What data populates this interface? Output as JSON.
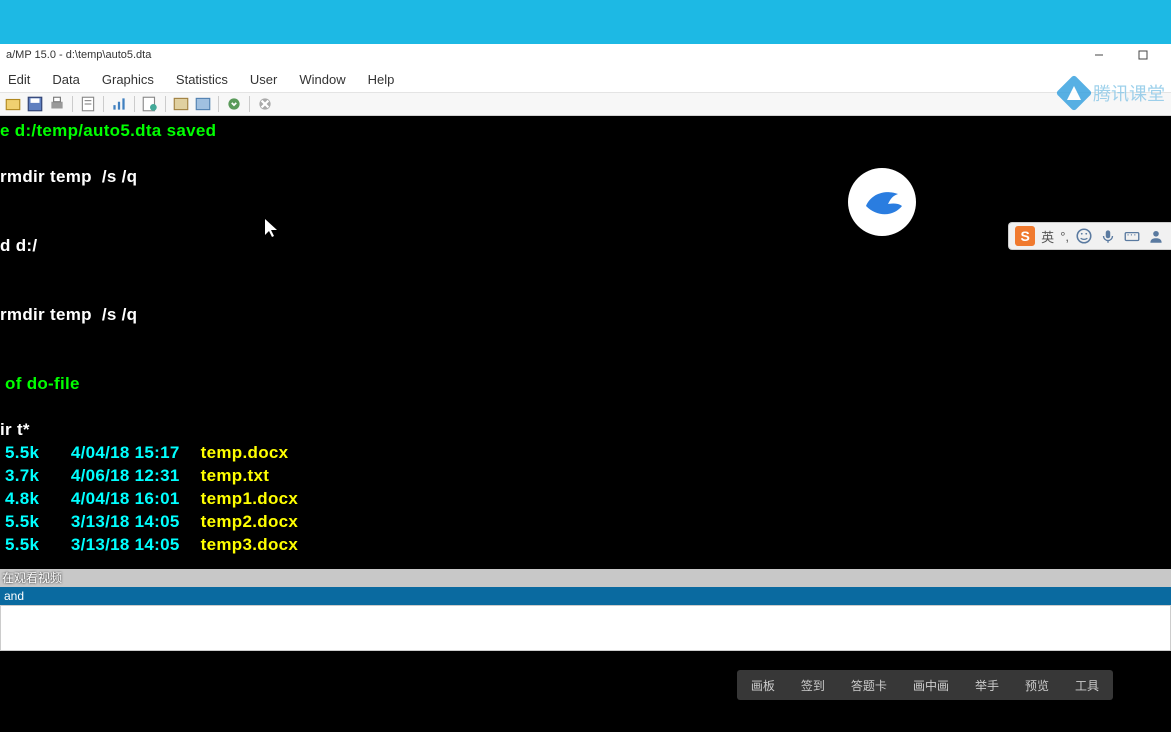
{
  "topbar": {},
  "titlebar": {
    "text": "a/MP 15.0 - d:\\temp\\auto5.dta"
  },
  "menubar": {
    "items": [
      "Edit",
      "Data",
      "Graphics",
      "Statistics",
      "User",
      "Window",
      "Help"
    ]
  },
  "terminal": {
    "lines": [
      {
        "cls": "g",
        "text": "e d:/temp/auto5.dta saved"
      },
      {
        "cls": "g",
        "text": ""
      },
      {
        "cls": "w",
        "text": "rmdir temp  /s /q"
      },
      {
        "cls": "w",
        "text": ""
      },
      {
        "cls": "w",
        "text": ""
      },
      {
        "cls": "w",
        "text": "d d:/"
      },
      {
        "cls": "w",
        "text": ""
      },
      {
        "cls": "w",
        "text": ""
      },
      {
        "cls": "w",
        "text": "rmdir temp  /s /q"
      },
      {
        "cls": "w",
        "text": ""
      },
      {
        "cls": "w",
        "text": ""
      },
      {
        "cls": "g",
        "text": " of do-file"
      },
      {
        "cls": "g",
        "text": ""
      },
      {
        "cls": "w",
        "text": "ir t*"
      }
    ],
    "files": [
      {
        "size": "5.5k",
        "date": "4/04/18 15:17",
        "name": "temp.docx"
      },
      {
        "size": "3.7k",
        "date": "4/06/18 12:31",
        "name": "temp.txt"
      },
      {
        "size": "4.8k",
        "date": "4/04/18 16:01",
        "name": "temp1.docx"
      },
      {
        "size": "5.5k",
        "date": "3/13/18 14:05",
        "name": "temp2.docx"
      },
      {
        "size": "5.5k",
        "date": "3/13/18 14:05",
        "name": "temp3.docx"
      }
    ]
  },
  "status": {
    "text": "在观看视频"
  },
  "cmdbar": {
    "label": "and"
  },
  "video_toolbar": {
    "items": [
      "画板",
      "签到",
      "答题卡",
      "画中画",
      "举手",
      "预览",
      "工具"
    ]
  },
  "brand": {
    "text": "腾讯课堂"
  },
  "ime": {
    "s": "S",
    "lang": "英"
  }
}
